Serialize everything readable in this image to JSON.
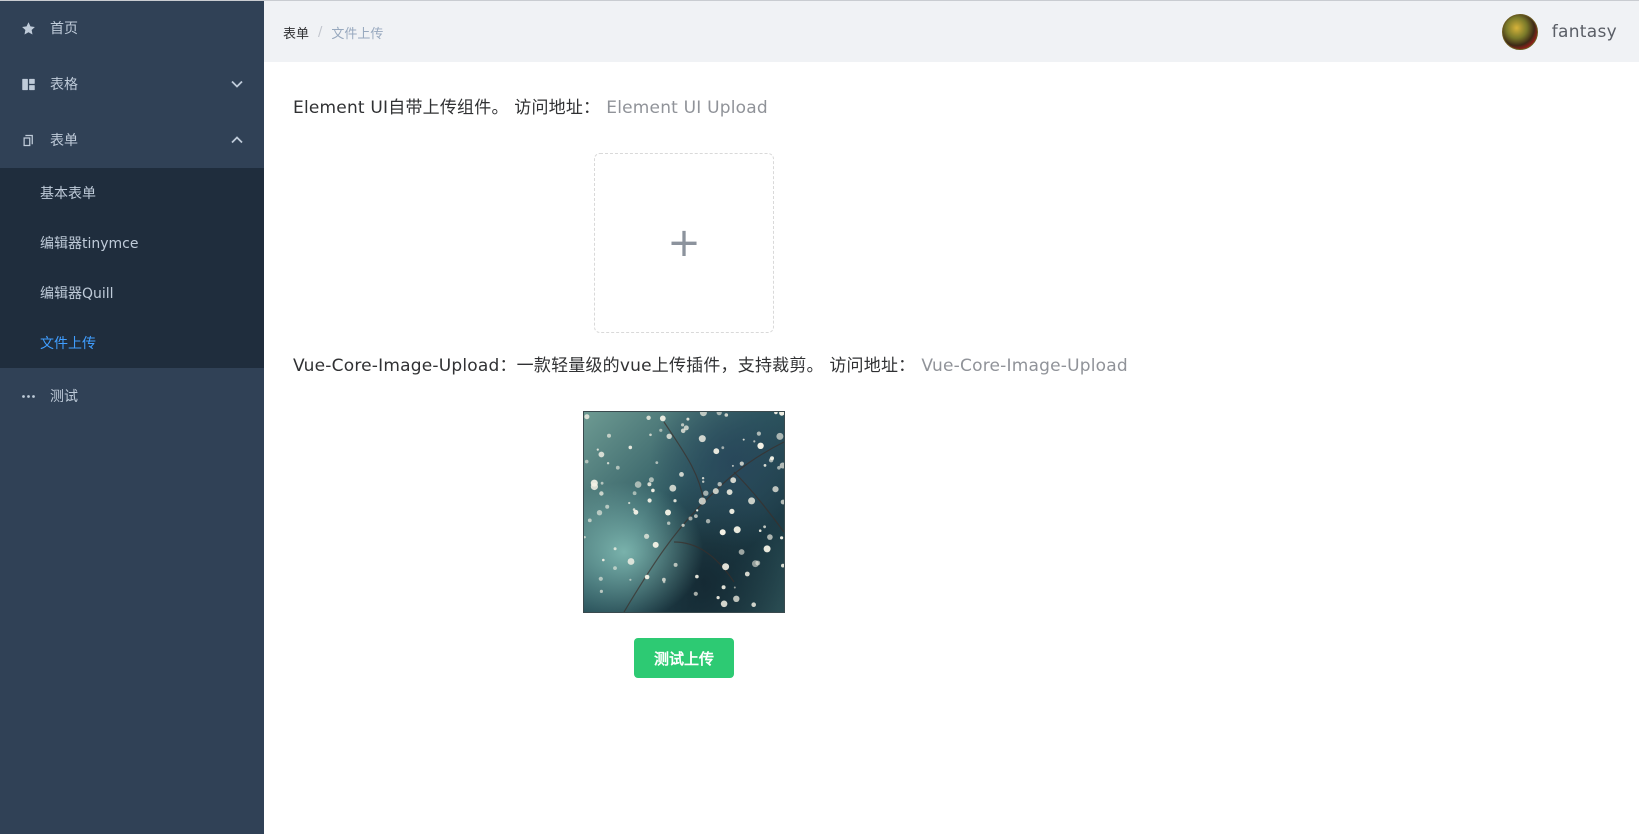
{
  "sidebar": {
    "items": [
      {
        "label": "首页",
        "icon": "star-icon"
      },
      {
        "label": "表格",
        "icon": "table-icon",
        "expanded": false
      },
      {
        "label": "表单",
        "icon": "form-icon",
        "expanded": true,
        "children": [
          {
            "label": "基本表单",
            "active": false
          },
          {
            "label": "编辑器tinymce",
            "active": false
          },
          {
            "label": "编辑器Quill",
            "active": false
          },
          {
            "label": "文件上传",
            "active": true
          }
        ]
      },
      {
        "label": "测试",
        "icon": "more-icon"
      }
    ]
  },
  "header": {
    "breadcrumb": [
      "表单",
      "文件上传"
    ],
    "username": "fantasy"
  },
  "main": {
    "element_upload": {
      "intro": "Element UI自带上传组件。 访问地址：",
      "link": "Element UI Upload",
      "plus": "+"
    },
    "core_upload": {
      "intro": "Vue-Core-Image-Upload：一款轻量级的vue上传插件，支持裁剪。 访问地址：",
      "link": "Vue-Core-Image-Upload",
      "button_label": "测试上传"
    }
  },
  "colors": {
    "sidebar_bg": "#304156",
    "submenu_bg": "#1f2d3d",
    "active": "#409eff",
    "button": "#2dca73"
  }
}
